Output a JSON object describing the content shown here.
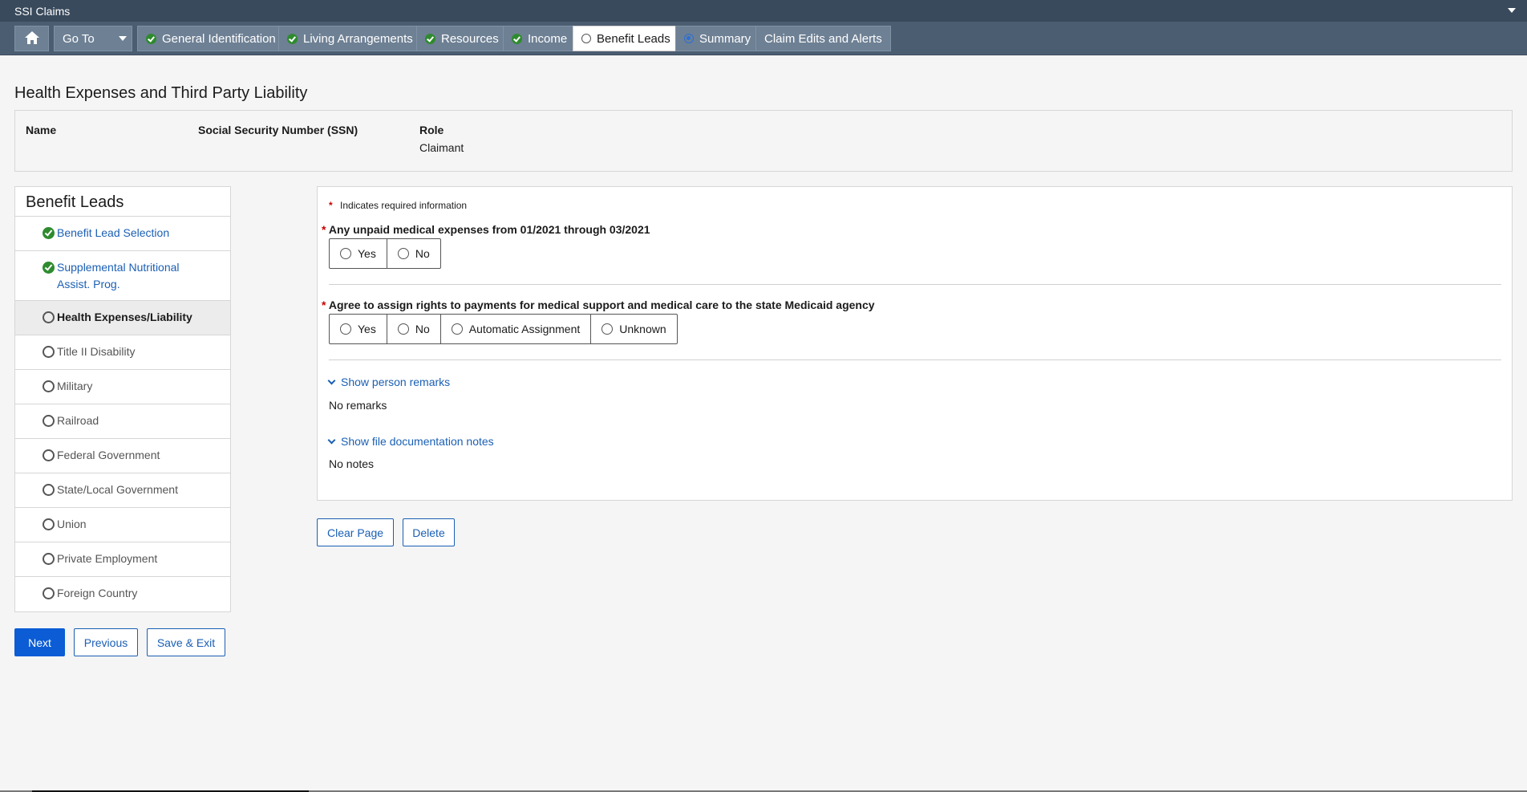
{
  "app": {
    "title": "SSI Claims"
  },
  "nav": {
    "goto_label": "Go To",
    "tabs": [
      {
        "label": "General Identification",
        "status": "complete"
      },
      {
        "label": "Living Arrangements",
        "status": "complete"
      },
      {
        "label": "Resources",
        "status": "complete"
      },
      {
        "label": "Income",
        "status": "complete"
      },
      {
        "label": "Benefit Leads",
        "status": "current"
      },
      {
        "label": "Summary",
        "status": "selected"
      },
      {
        "label": "Claim Edits and Alerts",
        "status": "none"
      }
    ]
  },
  "page": {
    "title": "Health Expenses and Third Party Liability"
  },
  "person": {
    "name_label": "Name",
    "name_value": "",
    "ssn_label": "Social Security Number (SSN)",
    "ssn_value": "",
    "role_label": "Role",
    "role_value": "Claimant"
  },
  "sidebar": {
    "title": "Benefit Leads",
    "items": [
      {
        "label": "Benefit Lead Selection",
        "status": "complete"
      },
      {
        "label": "Supplemental Nutritional Assist. Prog.",
        "status": "complete"
      },
      {
        "label": "Health Expenses/Liability",
        "status": "current"
      },
      {
        "label": "Title II Disability",
        "status": "incomplete"
      },
      {
        "label": "Military",
        "status": "incomplete"
      },
      {
        "label": "Railroad",
        "status": "incomplete"
      },
      {
        "label": "Federal Government",
        "status": "incomplete"
      },
      {
        "label": "State/Local Government",
        "status": "incomplete"
      },
      {
        "label": "Union",
        "status": "incomplete"
      },
      {
        "label": "Private Employment",
        "status": "incomplete"
      },
      {
        "label": "Foreign Country",
        "status": "incomplete"
      }
    ]
  },
  "form": {
    "required_note": "Indicates required information",
    "required_marker": "*",
    "q1": {
      "label": "Any unpaid medical expenses from 01/2021 through 03/2021",
      "options": [
        "Yes",
        "No"
      ]
    },
    "q2": {
      "label": "Agree to assign rights to payments for medical support and medical care to the state Medicaid agency",
      "options": [
        "Yes",
        "No",
        "Automatic Assignment",
        "Unknown"
      ]
    },
    "remarks_toggle": "Show person remarks",
    "remarks_value": "No remarks",
    "notes_toggle": "Show file documentation notes",
    "notes_value": "No notes"
  },
  "actions": {
    "clear_page": "Clear Page",
    "delete": "Delete",
    "next": "Next",
    "previous": "Previous",
    "save_exit": "Save & Exit"
  },
  "colors": {
    "topbar": "#394a5c",
    "navbar": "#4b5d71",
    "link": "#1a5fb4",
    "primary": "#0b5cd5",
    "complete": "#2e8b2e"
  }
}
